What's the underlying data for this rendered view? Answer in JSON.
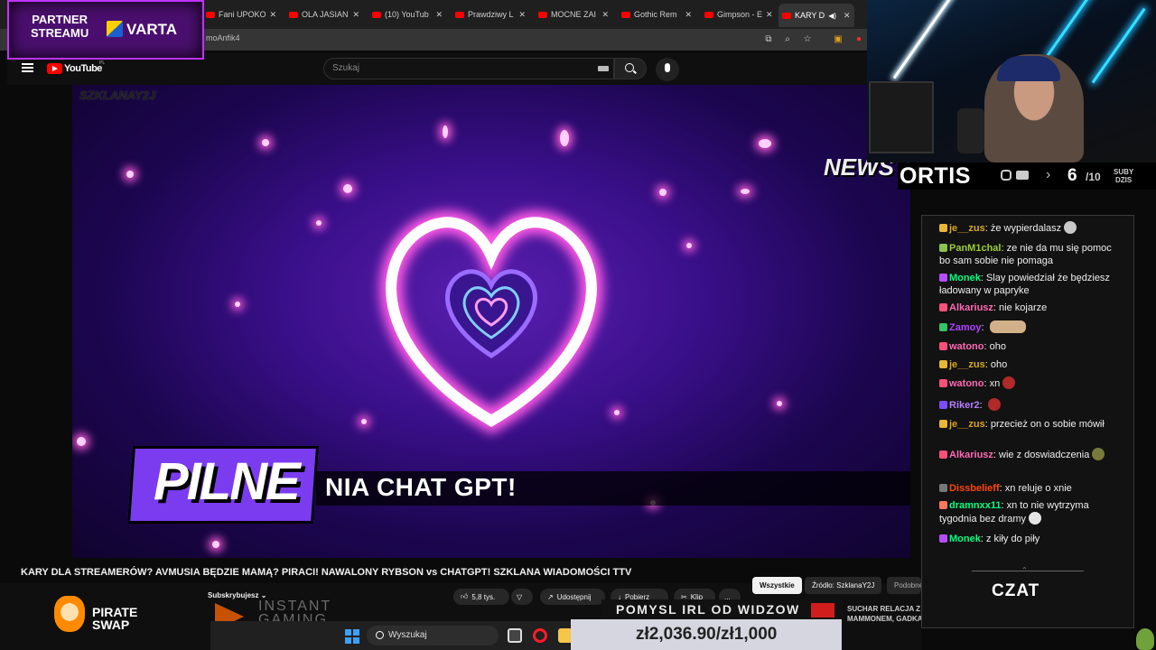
{
  "partner": {
    "line1": "PARTNER",
    "line2": "STREAMU",
    "brand": "VARTA"
  },
  "browser": {
    "tabs": [
      {
        "label": "Fani UPOKO"
      },
      {
        "label": "OLA JASIAN"
      },
      {
        "label": "(10) YouTub"
      },
      {
        "label": "Prawdziwy L"
      },
      {
        "label": "MOCNE ZAI"
      },
      {
        "label": "Gothic Rem"
      },
      {
        "label": "Gimpson - E"
      },
      {
        "label": "KARY D"
      }
    ],
    "url": "moAnfik4"
  },
  "youtube": {
    "logo": "YouTube",
    "region": "PL",
    "search_placeholder": "Szukaj",
    "video_title": "KARY DLA STREAMERÓW? AVMUSIA BĘDZIE MAMĄ? PIRACI! NAWALONY RYBSON vs CHATGPT! SZKLANA WIADOMOŚCI TTV",
    "subscribed": "Subskrybujesz",
    "likes": "5,8 tys.",
    "share": "Udostępnij",
    "download": "Pobierz",
    "clip": "Klip",
    "more": "...",
    "chips": [
      "Wszystkie",
      "Źródło: SzklanaY2J",
      "Podobne"
    ]
  },
  "video": {
    "watermark": "SZKLANAY2J",
    "news_logo": "NEWS",
    "pilne": "PILNE",
    "ticker": "NIA CHAT GPT!"
  },
  "overlay": {
    "pirate_line1": "PIRATE",
    "pirate_line2": "SWAP",
    "instant_line1": "INSTANT",
    "instant_line2": "GAMING",
    "irl_banner": "POMYSL IRL OD WIDZOW",
    "donation": "zł2,036.90/zł1,000",
    "side_news_line1": "SUCHAR RELACJA Z I",
    "side_news_line2": "MAMMONEM, GADKA"
  },
  "taskbar": {
    "search_placeholder": "Wyszukaj"
  },
  "stream": {
    "streamer": "ORTIS",
    "subs_now": "6",
    "subs_goal": "/10",
    "subs_label_1": "SUBY",
    "subs_label_2": "DZIS"
  },
  "chat": {
    "title": "CZAT",
    "messages": [
      {
        "user": "je__zus",
        "text": "że wypierdalasz",
        "color": "#daa520"
      },
      {
        "user": "PanM1chal",
        "text": "ze nie da mu się pomoc bo sam sobie nie pomaga",
        "color": "#9acd32"
      },
      {
        "user": "Monek",
        "text": "Slay powiedział że będziesz ładowany w papryke",
        "color": "#00ff7f"
      },
      {
        "user": "Alkariusz",
        "text": "nie kojarze",
        "color": "#ff69b4"
      },
      {
        "user": "Zamoy",
        "text": "",
        "color": "#b040ff"
      },
      {
        "user": "watono",
        "text": "oho",
        "color": "#ff69b4"
      },
      {
        "user": "je__zus",
        "text": "oho",
        "color": "#daa520"
      },
      {
        "user": "watono",
        "text": "xn",
        "color": "#ff69b4"
      },
      {
        "user": "Riker2",
        "text": "",
        "color": "#b77dff"
      },
      {
        "user": "je__zus",
        "text": "przecież on o sobie mówił",
        "color": "#daa520"
      },
      {
        "user": "Alkariusz",
        "text": "wie z doswiadczenia",
        "color": "#ff69b4"
      },
      {
        "user": "Dissbelieff",
        "text": "xn reluje o xnie",
        "color": "#ff4500"
      },
      {
        "user": "dramnxx11",
        "text": "xn to nie wytrzyma tygodnia bez dramy",
        "color": "#00ff7f"
      },
      {
        "user": "Monek",
        "text": "z kiły do piły",
        "color": "#00ff7f"
      }
    ]
  },
  "colors": {
    "youtube_red": "#ff0000",
    "partner_purple": "#4a0f6e",
    "pilne_purple": "#7b3cf0",
    "neon_cyan": "#32e1ff"
  }
}
